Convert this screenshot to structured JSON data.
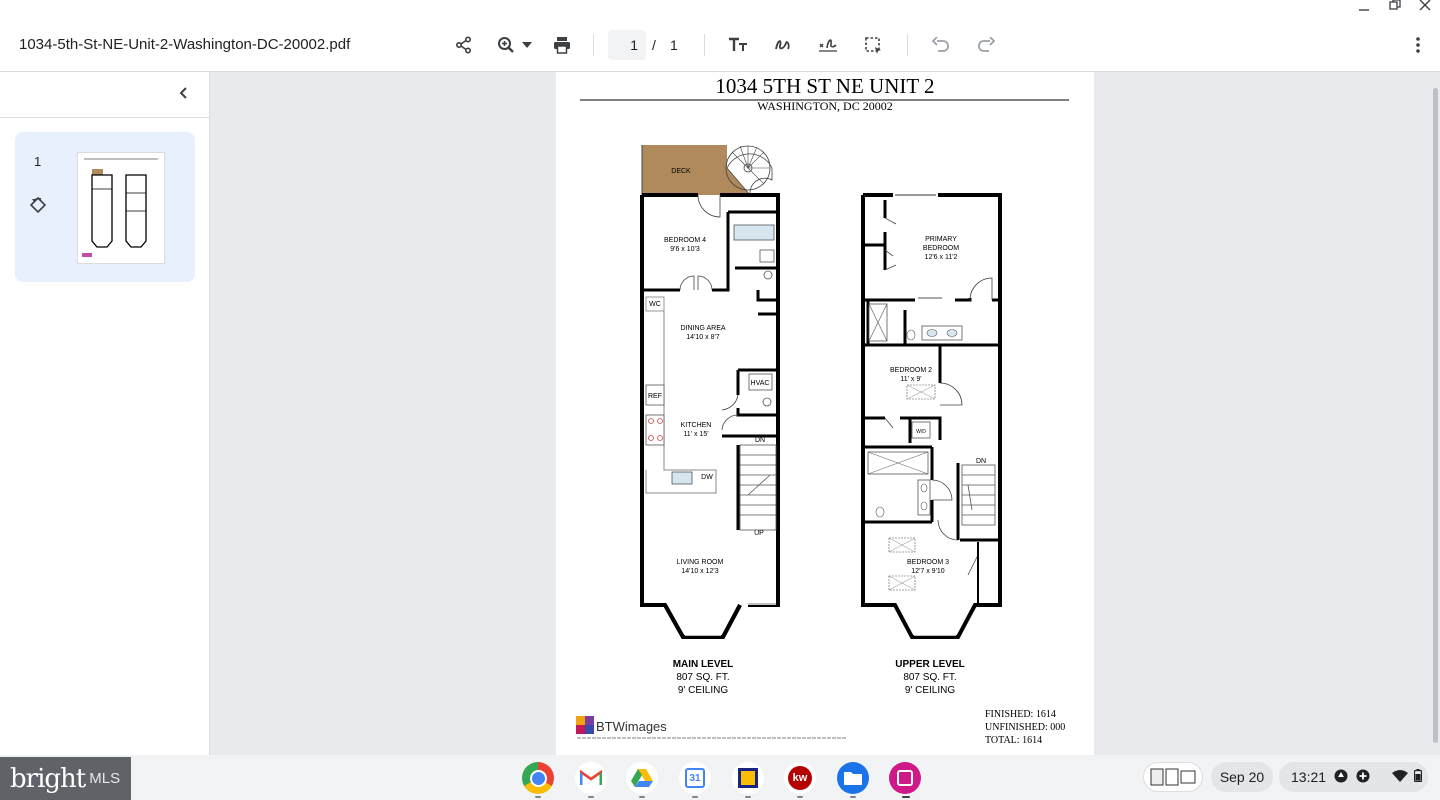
{
  "window": {
    "filename": "1034-5th-St-NE-Unit-2-Washington-DC-20002.pdf"
  },
  "toolbar": {
    "page_current": "1",
    "page_sep": "/",
    "page_total": "1"
  },
  "sidebar": {
    "thumb_page": "1"
  },
  "floorplan": {
    "title": "1034 5TH ST NE UNIT 2",
    "subtitle": "WASHINGTON, DC 20002",
    "main": {
      "deck": "DECK",
      "bed4": "BEDROOM 4",
      "bed4_dim": "9'6 x 10'3",
      "wc": "WC",
      "dining": "DINING AREA",
      "dining_dim": "14'10 x 8'7",
      "hvac": "HVAC",
      "ref": "REF",
      "kitchen": "KITCHEN",
      "kitchen_dim": "11' x 15'",
      "dw": "DW",
      "dn": "DN",
      "up": "UP",
      "living": "LIVING ROOM",
      "living_dim": "14'10 x 12'3",
      "level": "MAIN LEVEL",
      "sqft": "807 SQ. FT.",
      "ceiling": "9' CEILING"
    },
    "upper": {
      "primary1": "PRIMARY",
      "primary2": "BEDROOM",
      "primary_dim": "12'6 x 11'2",
      "bed2": "BEDROOM 2",
      "bed2_dim": "11' x 9'",
      "wd": "W/D",
      "dn": "DN",
      "bed3": "BEDROOM 3",
      "bed3_dim": "12'7 x 9'10",
      "level": "UPPER LEVEL",
      "sqft": "807 SQ. FT.",
      "ceiling": "9' CEILING"
    },
    "totals": {
      "finished": "FINISHED: 1614",
      "unfinished": "UNFINISHED: 000",
      "total": "TOTAL: 1614"
    },
    "brand": "BTWimages"
  },
  "taskbar": {
    "watermark_main": "bright",
    "watermark_sub": "MLS",
    "date": "Sep 20",
    "time": "13:21",
    "calendar_day": "31"
  },
  "colors": {
    "deck": "#b08a5c",
    "window_wall": "#000000",
    "selected_thumb": "#e8f0fe"
  }
}
